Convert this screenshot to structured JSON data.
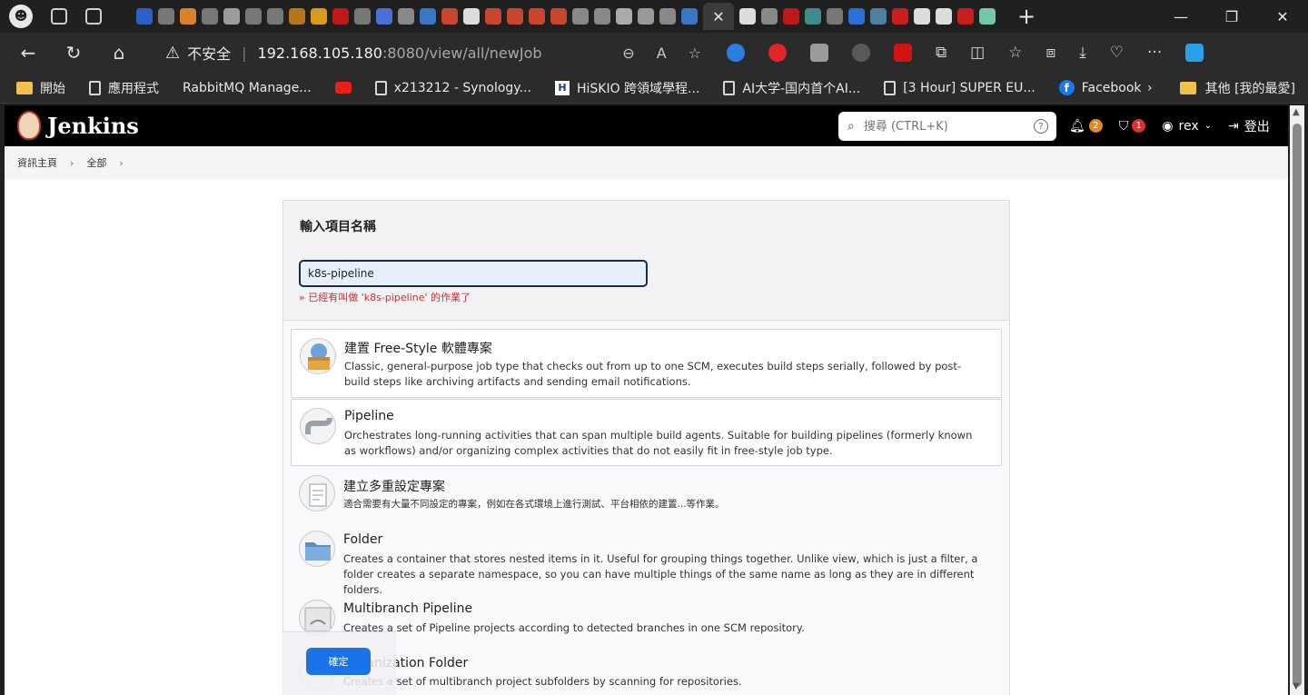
{
  "browser": {
    "address": {
      "security_label": "不安全",
      "host": "192.168.105.180",
      "path": ":8080/view/all/newJob"
    },
    "bookmarks": [
      {
        "label": "開始",
        "icon": "folder-icon"
      },
      {
        "label": "應用程式",
        "icon": "page-icon"
      },
      {
        "label": "RabbitMQ Manage...",
        "icon": "rabbit-icon"
      },
      {
        "label": "x213212 - Synology...",
        "icon": "page-icon"
      },
      {
        "label": "HiSKIO 跨領域學程...",
        "icon": "hiskio-icon"
      },
      {
        "label": "AI大学-国内首个AI...",
        "icon": "page-icon"
      },
      {
        "label": "[3 Hour] SUPER EU...",
        "icon": "page-icon"
      },
      {
        "label": "Facebook",
        "icon": "facebook-icon"
      }
    ],
    "bookmarks_other": "其他 [我的最愛]"
  },
  "jenkins": {
    "title": "Jenkins",
    "search_placeholder": "搜尋 (CTRL+K)",
    "notifications_count": "2",
    "security_count": "1",
    "user": "rex",
    "logout": "登出",
    "breadcrumb": [
      "資訊主頁",
      "全部"
    ],
    "new_item": {
      "label": "輸入項目名稱",
      "value": "k8s-pipeline",
      "error": "» 已經有叫做 'k8s-pipeline' 的作業了"
    },
    "job_types": [
      {
        "title": "建置 Free-Style 軟體專案",
        "desc": "Classic, general-purpose job type that checks out from up to one SCM, executes build steps serially, followed by post-build steps like archiving artifacts and sending email notifications."
      },
      {
        "title": "Pipeline",
        "desc": "Orchestrates long-running activities that can span multiple build agents. Suitable for building pipelines (formerly known as workflows) and/or organizing complex activities that do not easily fit in free-style job type."
      },
      {
        "title": "建立多重設定專案",
        "desc": "適合需要有大量不同設定的專案，例如在各式環境上進行測試、平台相依的建置...等作業。"
      },
      {
        "title": "Folder",
        "desc": "Creates a container that stores nested items in it. Useful for grouping things together. Unlike view, which is just a filter, a folder creates a separate namespace, so you can have multiple things of the same name as long as they are in different folders."
      },
      {
        "title": "Multibranch Pipeline",
        "desc": "Creates a set of Pipeline projects according to detected branches in one SCM repository."
      },
      {
        "title": "Organization Folder",
        "desc": "Creates a set of multibranch project subfolders by scanning for repositories."
      }
    ],
    "ok_button": "確定"
  }
}
